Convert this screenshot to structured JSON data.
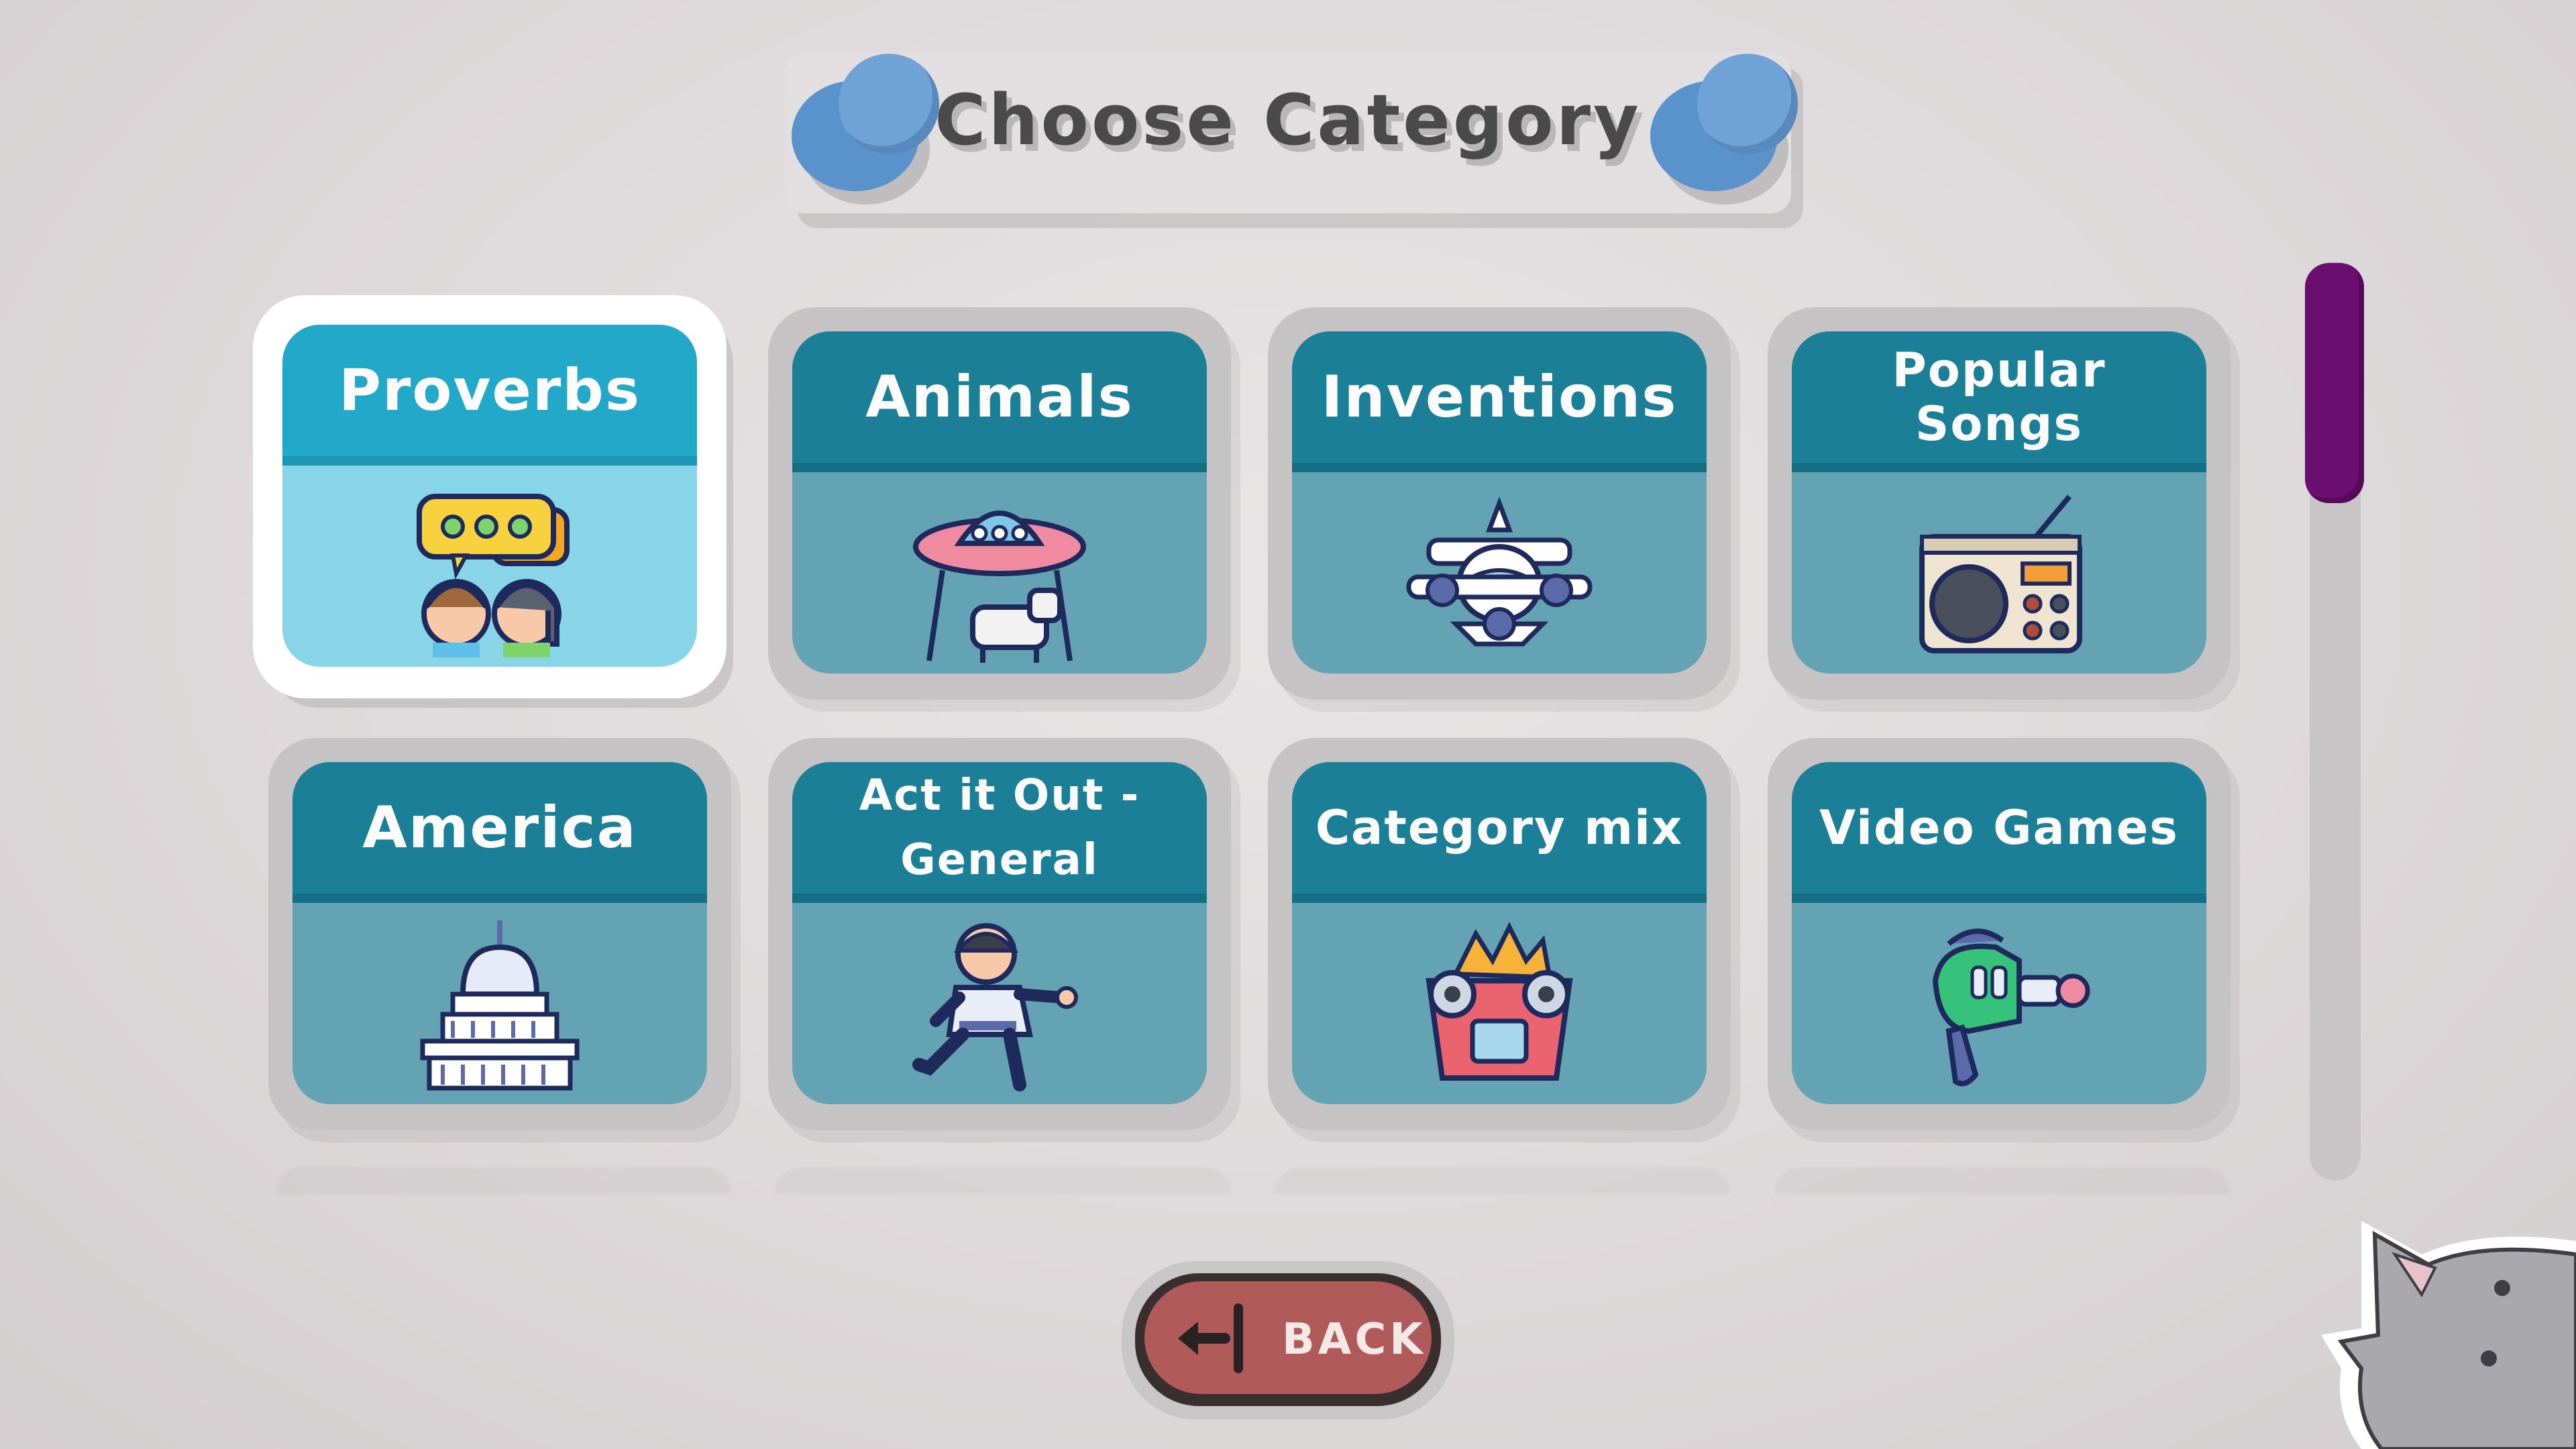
{
  "title": "Choose Category",
  "categories": [
    {
      "label": "Proverbs",
      "icon": "speech-bubbles-people-icon",
      "selected": true
    },
    {
      "label": "Animals",
      "icon": "ufo-abducting-cow-icon",
      "selected": false
    },
    {
      "label": "Inventions",
      "icon": "airplane-icon",
      "selected": false
    },
    {
      "label": "Popular Songs",
      "icon": "radio-icon",
      "selected": false
    },
    {
      "label": "America",
      "icon": "capitol-building-icon",
      "selected": false
    },
    {
      "label": "Act it Out - General",
      "icon": "karate-person-icon",
      "selected": false
    },
    {
      "label": "Category mix",
      "icon": "burning-car-icon",
      "selected": false
    },
    {
      "label": "Video Games",
      "icon": "ray-gun-icon",
      "selected": false
    }
  ],
  "back_button": {
    "label": "BACK",
    "icon": "exit-arrow-icon"
  },
  "colors": {
    "card_header": "#1b7f97",
    "card_body": "#63a3b3",
    "selected_header": "#22a9c9",
    "selected_body": "#88d5e8",
    "scroll_thumb": "#6a0f6f",
    "back_button": "#b05a59",
    "pin": "#6fa3d6"
  }
}
